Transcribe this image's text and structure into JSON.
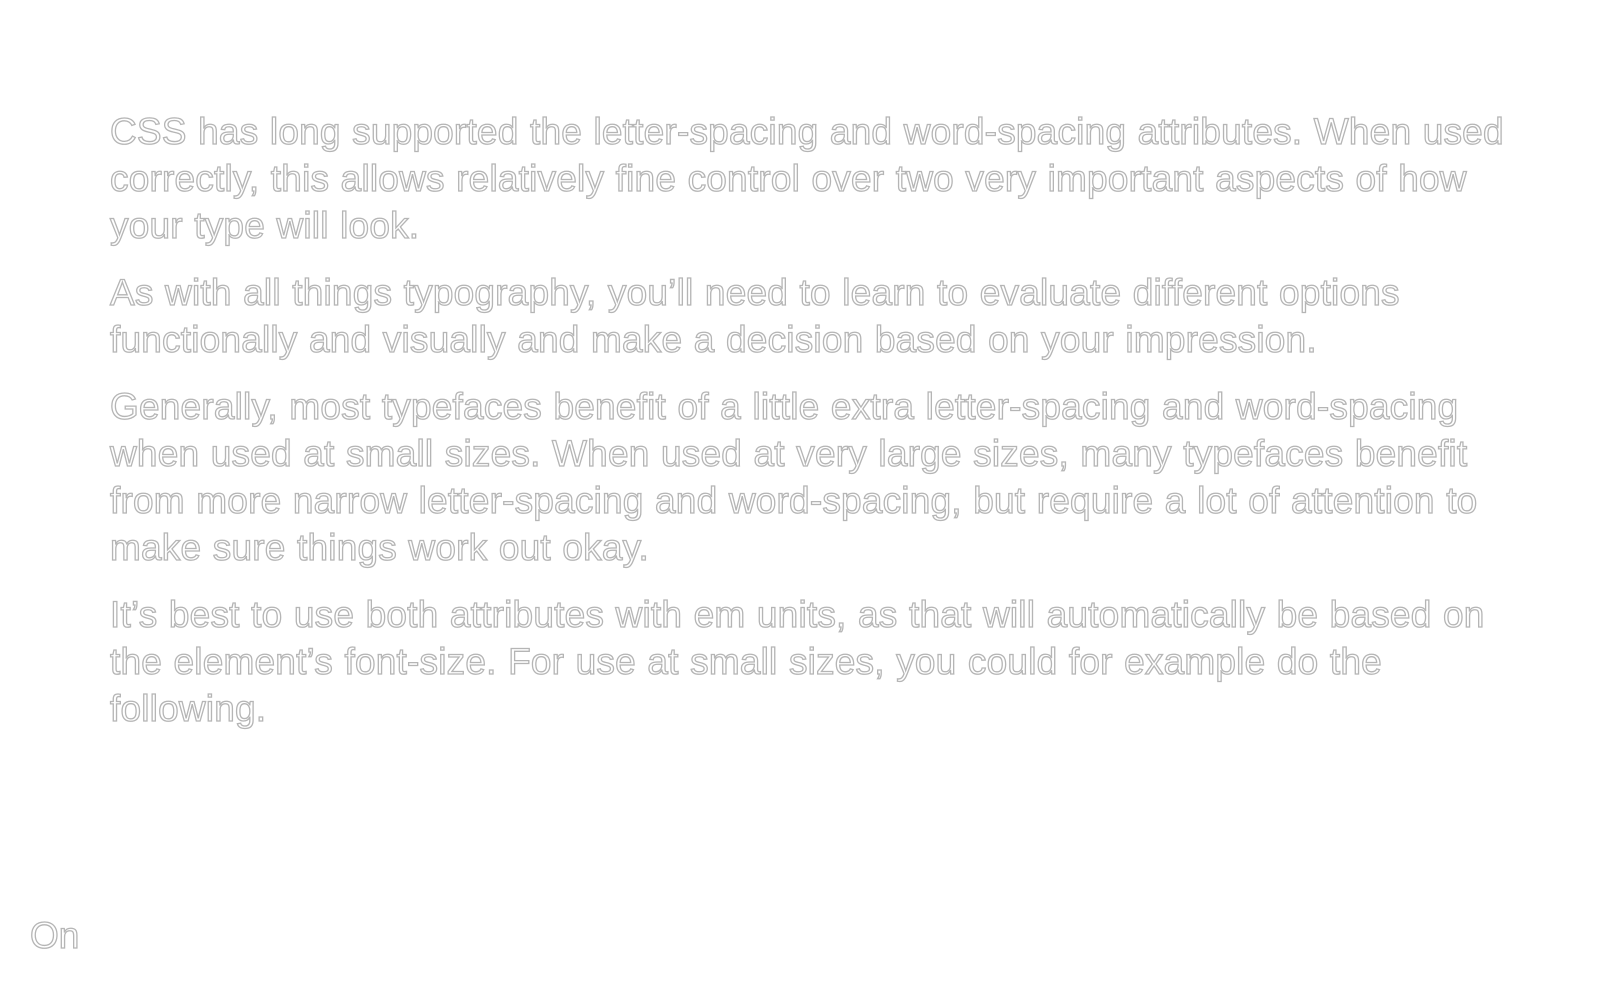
{
  "article": {
    "paragraphs": [
      "CSS has long supported the letter-spacing and word-spacing attributes. When used correctly, this allows relatively fine control over two very important aspects of how your type will look.",
      "As with all things typography, you’ll need to learn to evaluate different options functionally and visually and make a decision based on your impression.",
      "Generally, most typefaces benefit of a little extra letter-spacing and word-spacing when used at small sizes. When used at very large sizes, many typefaces benefit from more narrow letter-spacing and word-spacing, but require a lot of attention to make sure things work out okay.",
      "It’s best to use both attributes with em units, as that will automatically be based on the element’s font-size. For use at small sizes, you could for example do the following."
    ]
  },
  "toggle": {
    "label": "On"
  },
  "colors": {
    "background": "#ffffff",
    "text_outline": "#b5b5b5"
  }
}
